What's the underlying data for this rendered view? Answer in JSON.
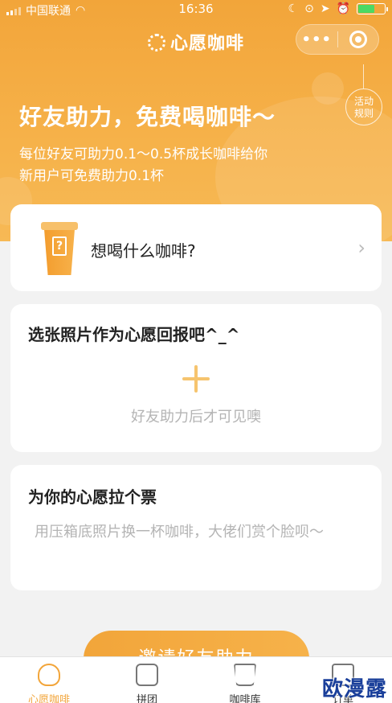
{
  "status_bar": {
    "carrier": "中国联通",
    "time": "16:36"
  },
  "nav": {
    "title": "心愿咖啡",
    "more_label": "•••"
  },
  "rules_badge": {
    "line1": "活动",
    "line2": "规则"
  },
  "hero": {
    "headline": "好友助力，免费喝咖啡～",
    "sub1": "每位好友可助力0.1～0.5杯成长咖啡给你",
    "sub2": "新用户可免费助力0.1杯"
  },
  "coffee_card": {
    "label": "想喝什么咖啡?",
    "chevron": "›"
  },
  "photo_card": {
    "title": "选张照片作为心愿回报吧^_^",
    "hint": "好友助力后才可见噢"
  },
  "vote_card": {
    "title": "为你的心愿拉个票",
    "hint": "用压箱底照片换一杯咖啡，大佬们赏个脸呗～"
  },
  "invite_button": {
    "label": "邀请好友助力"
  },
  "tabbar": {
    "tabs": [
      {
        "label": "心愿咖啡",
        "icon": "heart-cup-icon",
        "active": true
      },
      {
        "label": "拼团",
        "icon": "group-icon",
        "active": false
      },
      {
        "label": "咖啡库",
        "icon": "coffee-cup-icon",
        "active": false
      },
      {
        "label": "订单",
        "icon": "order-icon",
        "active": false
      }
    ]
  },
  "watermark": "欧漫露",
  "colors": {
    "accent": "#f2a53a",
    "background": "#f2f2f2"
  }
}
